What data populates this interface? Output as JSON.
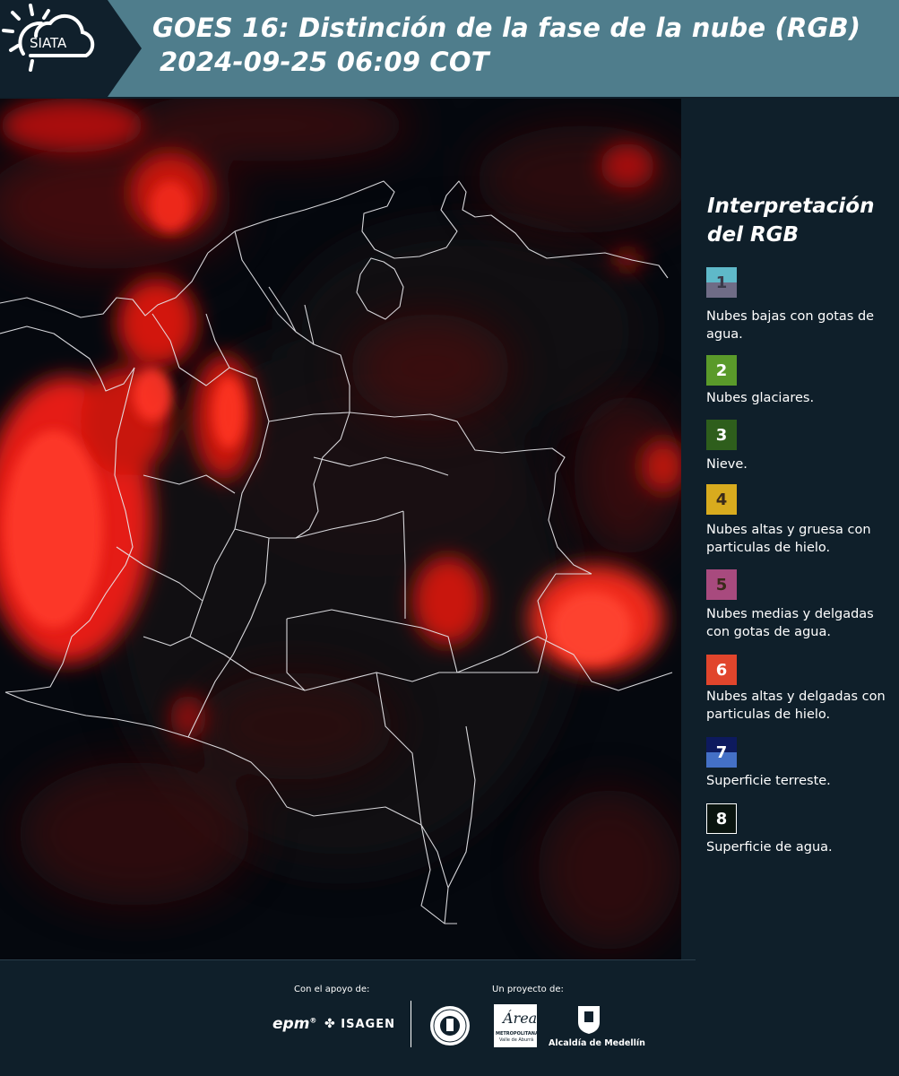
{
  "header": {
    "logo_text": "SIATA",
    "title_line1": "GOES 16: Distinción de la fase de la nube (RGB)",
    "title_line2": "2024-09-25 06:09 COT",
    "band_color": "#4f7d8c"
  },
  "legend": {
    "title_line1": "Interpretación",
    "title_line2": "del RGB",
    "items": [
      {
        "num": "1",
        "desc": "Nubes bajas con gotas de agua.",
        "color_top": "#5fb9c9",
        "color_bottom": "#6f6c86"
      },
      {
        "num": "2",
        "desc": "Nubes glaciares.",
        "color": "#5a9a2a"
      },
      {
        "num": "3",
        "desc": "Nieve.",
        "color": "#2e5e1c"
      },
      {
        "num": "4",
        "desc": "Nubes altas y gruesa con particulas de hielo.",
        "color": "#d8ab1e"
      },
      {
        "num": "5",
        "desc": "Nubes medias y delgadas con gotas de agua.",
        "color": "#a84a7e"
      },
      {
        "num": "6",
        "desc": "Nubes altas y delgadas con particulas de hielo.",
        "color": "#e1452c"
      },
      {
        "num": "7",
        "desc": "Superficie terreste.",
        "color_top": "#0d1a5e",
        "color_bottom": "#4470c6"
      },
      {
        "num": "8",
        "desc": "Superficie de agua.",
        "color": "#0a140f"
      }
    ]
  },
  "footer": {
    "support_label": "Con el apoyo de:",
    "project_label": "Un proyecto de:",
    "epm": "epm",
    "isagen": "ISAGEN",
    "area_name": "Área",
    "area_sub1": "METROPOLITANA",
    "area_sub2": "Valle de Aburrá",
    "alcaldia": "Alcaldía de Medellín"
  }
}
